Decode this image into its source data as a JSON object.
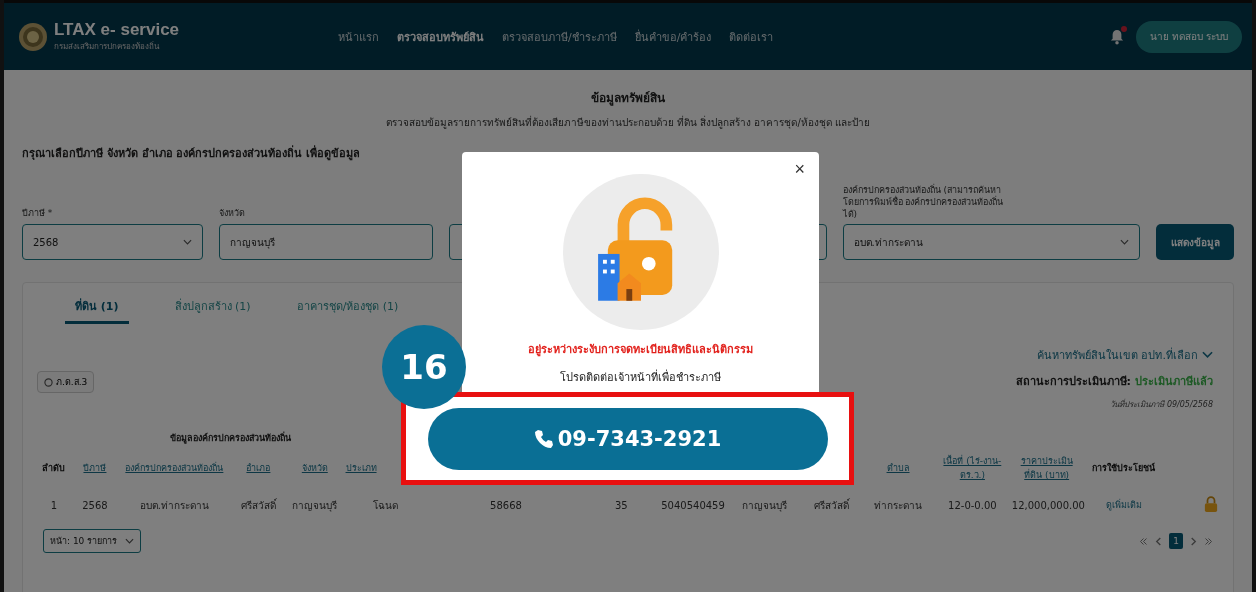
{
  "header": {
    "logo_title": "LTAX e- service",
    "logo_subtitle": "กรมส่งเสริมการปกครองท้องถิ่น",
    "notification_dot": true,
    "user_button": "นาย ทดสอบ ระบบ",
    "nav": [
      {
        "label": "หน้าแรก",
        "selected": false
      },
      {
        "label": "ตรวจสอบทรัพย์สิน",
        "selected": true
      },
      {
        "label": "ตรวจสอบภาษี/ชำระภาษี",
        "selected": false
      },
      {
        "label": "ยื่นคำขอ/คำร้อง",
        "selected": false
      },
      {
        "label": "ติดต่อเรา",
        "selected": false
      }
    ]
  },
  "page": {
    "title": "ข้อมูลทรัพย์สิน",
    "subtitle": "ตรวจสอบข้อมูลรายการทรัพย์สินที่ต้องเสียภาษีของท่านประกอบด้วย ที่ดิน สิ่งปลูกสร้าง อาคารชุด/ห้องชุด และป้าย",
    "instruction": "กรุณาเลือกปีภาษี จังหวัด อำเภอ องค์กรปกครองส่วนท้องถิ่น เพื่อดูข้อมูล"
  },
  "filters": [
    {
      "label": "ปีภาษี *",
      "value": "2568"
    },
    {
      "label": "จังหวัด",
      "value": "กาญจนบุรี"
    },
    {
      "label": "องค์กรปกครองส่วนท้องถิ่น (สามารถค้นหาโดยการพิมพ์ชื่อ องค์กรปกครองส่วนท้องถิ่น ได้)",
      "value": "อบต.ท่ากระดาน"
    }
  ],
  "show_button": "แสดงข้อมูล",
  "tabs": [
    {
      "label": "ที่ดิน (1)",
      "selected": true
    },
    {
      "label": "สิ่งปลูกสร้าง (1)",
      "selected": false
    },
    {
      "label": "อาคารชุด/ห้องชุด (1)",
      "selected": false
    }
  ],
  "search_toggle": "ค้นหาทรัพย์สินในเขต อปท.ที่เลือก",
  "status": {
    "label": "สถานะการประเมินภาษี:",
    "value": "ประเมินภาษีแล้ว",
    "date": "วันที่ประเมินภาษี 09/05/2568"
  },
  "report_button": "ภ.ด.ส.3",
  "table": {
    "group_header": "ข้อมูลองค์กรปกครองส่วนท้องถิ่น",
    "columns_left": [
      {
        "label": "ลำดับ",
        "sortable": false
      },
      {
        "label": "ปีภาษี",
        "sortable": true
      },
      {
        "label": "องค์กรปกครองส่วนท้องถิ่น",
        "sortable": true
      },
      {
        "label": "อำเภอ",
        "sortable": true
      },
      {
        "label": "จังหวัด",
        "sortable": true
      },
      {
        "label": "ประเภท",
        "sortable": true
      }
    ],
    "columns_right": [
      {
        "label": "ตำบล",
        "sortable": true
      },
      {
        "label": "เนื้อที่ (ไร่-งาน-ตร.ว.)",
        "sortable": true
      },
      {
        "label": "ราคาประเมินที่ดิน (บาท)",
        "sortable": true
      },
      {
        "label": "การใช้ประโยชน์",
        "sortable": false
      }
    ],
    "rows": [
      {
        "cells": [
          "1",
          "2568",
          "อบต.ท่ากระดาน",
          "ศรีสวัสดิ์",
          "กาญจนบุรี",
          "โฉนด",
          "58668",
          "35",
          "5040540459",
          "กาญจนบุรี",
          "ศรีสวัสดิ์",
          "ท่ากระดาน",
          "12-0-0.00",
          "12,000,000.00"
        ],
        "detail_link": "ดูเพิ่มเติม",
        "locked": true
      }
    ]
  },
  "page_size": "หน้า: 10 รายการ",
  "pagination": {
    "pages": [
      {
        "label": "1",
        "selected": true
      }
    ]
  },
  "modal": {
    "close": "×",
    "title": "อยู่ระหว่างระงับการจดทะเบียนสิทธิและนิติกรรม",
    "message": "โปรดติดต่อเจ้าหน้าที่เพื่อชำระภาษี",
    "phone": "09-7343-2921"
  },
  "annotation": {
    "step": "16"
  }
}
